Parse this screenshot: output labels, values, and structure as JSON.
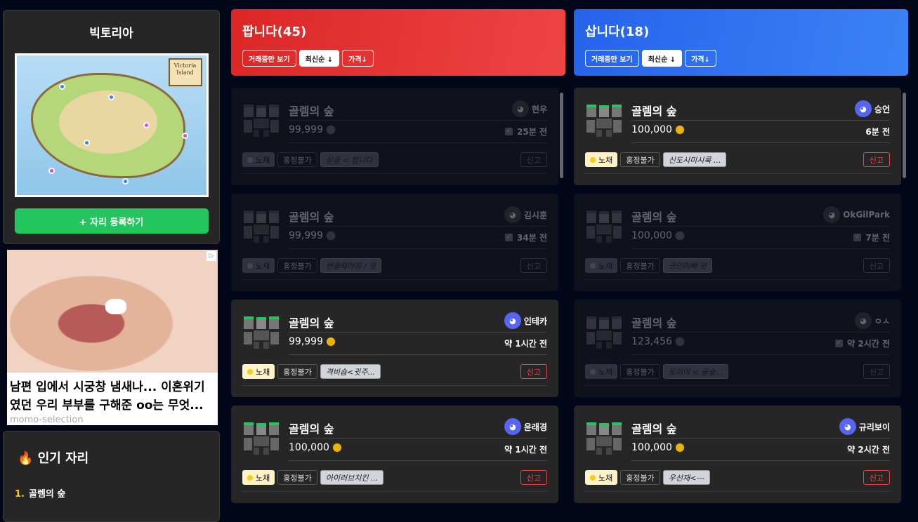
{
  "sidebar": {
    "map_title": "빅토리아",
    "map_sign": "Victoria Island",
    "add_button": "+ 자리 등록하기",
    "ad": {
      "headline": "남편 입에서 시궁창 냄새나... 이혼위기였던 우리 부부를 구해준 oo는 무엇...",
      "source": "momo-selection",
      "badge": "▷"
    },
    "popular": {
      "title": "인기 자리",
      "icon": "fire-icon",
      "items": [
        {
          "rank": "1.",
          "name": "골렘의 숲"
        }
      ]
    }
  },
  "sell": {
    "title": "팝니다(45)",
    "color": "#dc2626",
    "filters": [
      "거래중만 보기",
      "최신순 ↓",
      "가격↓"
    ],
    "cards": [
      {
        "map": "골렘의 숲",
        "user": "현우",
        "price": "99,999",
        "time": "25분 전",
        "status": "노채",
        "note": "홍정불가",
        "memo": "살콜 < 팝니다",
        "report": "신고",
        "active": false
      },
      {
        "map": "골렘의 숲",
        "user": "김시훈",
        "price": "99,999",
        "time": "34분 전",
        "status": "노채",
        "note": "홍정불가",
        "memo": "썬콜해야징 / 귓",
        "report": "신고",
        "active": false
      },
      {
        "map": "골렘의 숲",
        "user": "인테카",
        "price": "99,999",
        "time": "약 1시간 전",
        "status": "노채",
        "note": "홍정불가",
        "memo": "격비숍<귓주...",
        "report": "신고",
        "active": true
      },
      {
        "map": "골렘의 숲",
        "user": "윤래경",
        "price": "100,000",
        "time": "약 1시간 전",
        "status": "노채",
        "note": "홍정불가",
        "memo": "아이러브치킨 ...",
        "report": "신고",
        "active": true
      }
    ]
  },
  "buy": {
    "title": "삽니다(18)",
    "color": "#2563eb",
    "filters": [
      "거래중만 보기",
      "최신순 ↓",
      "가격↓"
    ],
    "cards": [
      {
        "map": "골렘의 숲",
        "user": "승언",
        "price": "100,000",
        "time": "6분 전",
        "status": "노채",
        "note": "홍정불가",
        "memo": "신도시미시룩 ...",
        "report": "신고",
        "active": true
      },
      {
        "map": "골렘의 숲",
        "user": "OkGilPark",
        "price": "100,000",
        "time": "7분 전",
        "status": "노채",
        "note": "홍정불가",
        "memo": "금민아빠 귓",
        "report": "신고",
        "active": false
      },
      {
        "map": "골렘의 숲",
        "user": "ㅇㅅ",
        "price": "123,456",
        "time": "약 2시간 전",
        "status": "노채",
        "note": "홍정불가",
        "memo": "도리야 < 골숲...",
        "report": "신고",
        "active": false
      },
      {
        "map": "골렘의 숲",
        "user": "규리보이",
        "price": "100,000",
        "time": "약 2시간 전",
        "status": "노채",
        "note": "홍정불가",
        "memo": "우선재<---",
        "report": "신고",
        "active": true
      }
    ]
  }
}
